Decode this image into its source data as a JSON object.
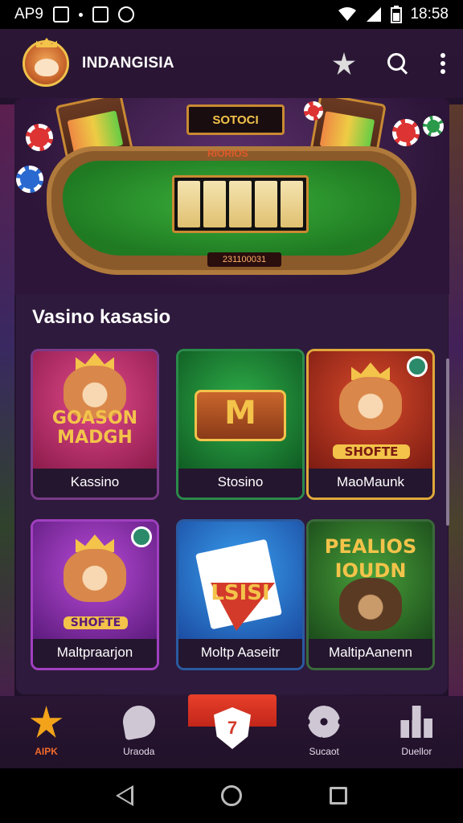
{
  "status_bar": {
    "left_text": "AP9",
    "time": "18:58"
  },
  "app_bar": {
    "title": "INDANGISIA"
  },
  "hero": {
    "sign_text": "SOTOCI",
    "felt_label": "RIORIOS",
    "felt_number": "231100031"
  },
  "section": {
    "title": "Vasino kasasio"
  },
  "games": [
    {
      "label": "Kassino",
      "art_text": "GOASON MADGH"
    },
    {
      "label": "Stosino",
      "art_text": "M"
    },
    {
      "label": "MaoMaunk",
      "art_text": "SHOFTE"
    },
    {
      "label": "Maltpraarjon",
      "art_text": "SHOFTE"
    },
    {
      "label": "Moltp Aaseitr",
      "art_text": "LSISI"
    },
    {
      "label": "MaltipAanenn",
      "art_text": "PEALIOS IOUDN"
    }
  ],
  "bottom_nav": {
    "items": [
      {
        "label": "AIPK",
        "icon": "star-icon"
      },
      {
        "label": "Uraoda",
        "icon": "chat-icon"
      },
      {
        "label": "",
        "icon": "shield-icon"
      },
      {
        "label": "Sucaot",
        "icon": "gear-icon"
      },
      {
        "label": "Duellor",
        "icon": "profile-icon"
      }
    ],
    "center_glyph": "7"
  },
  "colors": {
    "accent": "#e8402a",
    "panel": "#2e1a3c",
    "home_star": "#f2a31a"
  }
}
